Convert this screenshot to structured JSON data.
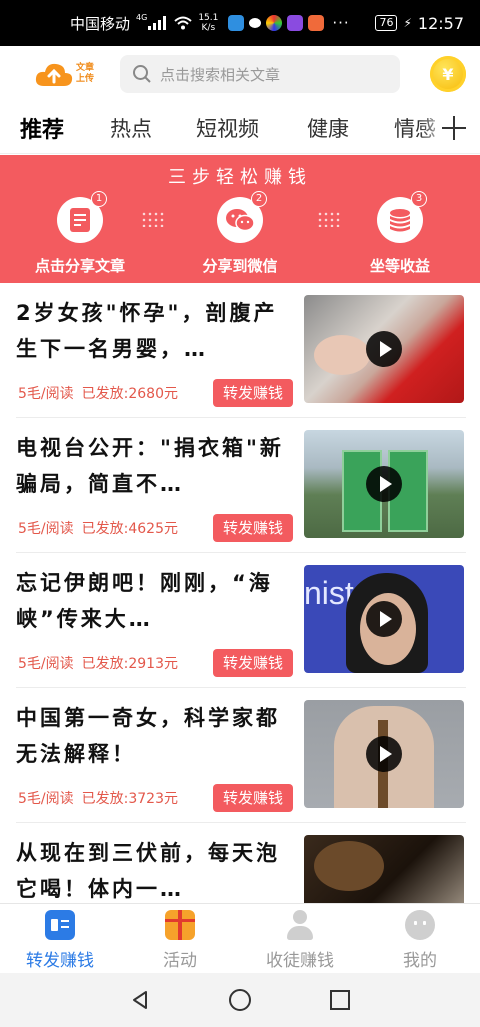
{
  "status_bar": {
    "carrier": "中国移动",
    "network": "4G",
    "speed_value": "15.1",
    "speed_unit": "K/s",
    "battery": "76",
    "time": "12:57"
  },
  "top_bar": {
    "upload_label_line1": "文章",
    "upload_label_line2": "上传",
    "search_placeholder": "点击搜索相关文章",
    "coin_symbol": "¥"
  },
  "tabs": [
    {
      "label": "推荐",
      "active": true
    },
    {
      "label": "热点"
    },
    {
      "label": "短视频"
    },
    {
      "label": "健康"
    },
    {
      "label": "情感"
    }
  ],
  "banner": {
    "title": "三步轻松赚钱",
    "steps": [
      {
        "number": "1",
        "label": "点击分享文章",
        "icon": "article-icon"
      },
      {
        "number": "2",
        "label": "分享到微信",
        "icon": "wechat-icon"
      },
      {
        "number": "3",
        "label": "坐等收益",
        "icon": "coins-icon"
      }
    ]
  },
  "articles": [
    {
      "title": "2岁女孩\"怀孕\"，剖腹产生下一名男婴，…",
      "price": "5毛/阅读",
      "sent": "已发放:2680元",
      "button": "转发赚钱"
    },
    {
      "title": "电视台公开：\"捐衣箱\"新骗局，简直不…",
      "price": "5毛/阅读",
      "sent": "已发放:4625元",
      "button": "转发赚钱"
    },
    {
      "title": "忘记伊朗吧！刚刚，“海峡”传来大…",
      "price": "5毛/阅读",
      "sent": "已发放:2913元",
      "button": "转发赚钱"
    },
    {
      "title": "中国第一奇女，科学家都无法解释！",
      "price": "5毛/阅读",
      "sent": "已发放:3723元",
      "button": "转发赚钱"
    },
    {
      "title": "从现在到三伏前，每天泡它喝！体内一…",
      "price": "",
      "sent": "",
      "button": ""
    }
  ],
  "thumb_text_3": "nist",
  "bottom_nav": [
    {
      "label": "转发赚钱",
      "active": true
    },
    {
      "label": "活动"
    },
    {
      "label": "收徒赚钱"
    },
    {
      "label": "我的"
    }
  ],
  "colors": {
    "accent_red": "#f35b5f",
    "active_blue": "#2c7be5",
    "coin_yellow": "#f6b600"
  }
}
